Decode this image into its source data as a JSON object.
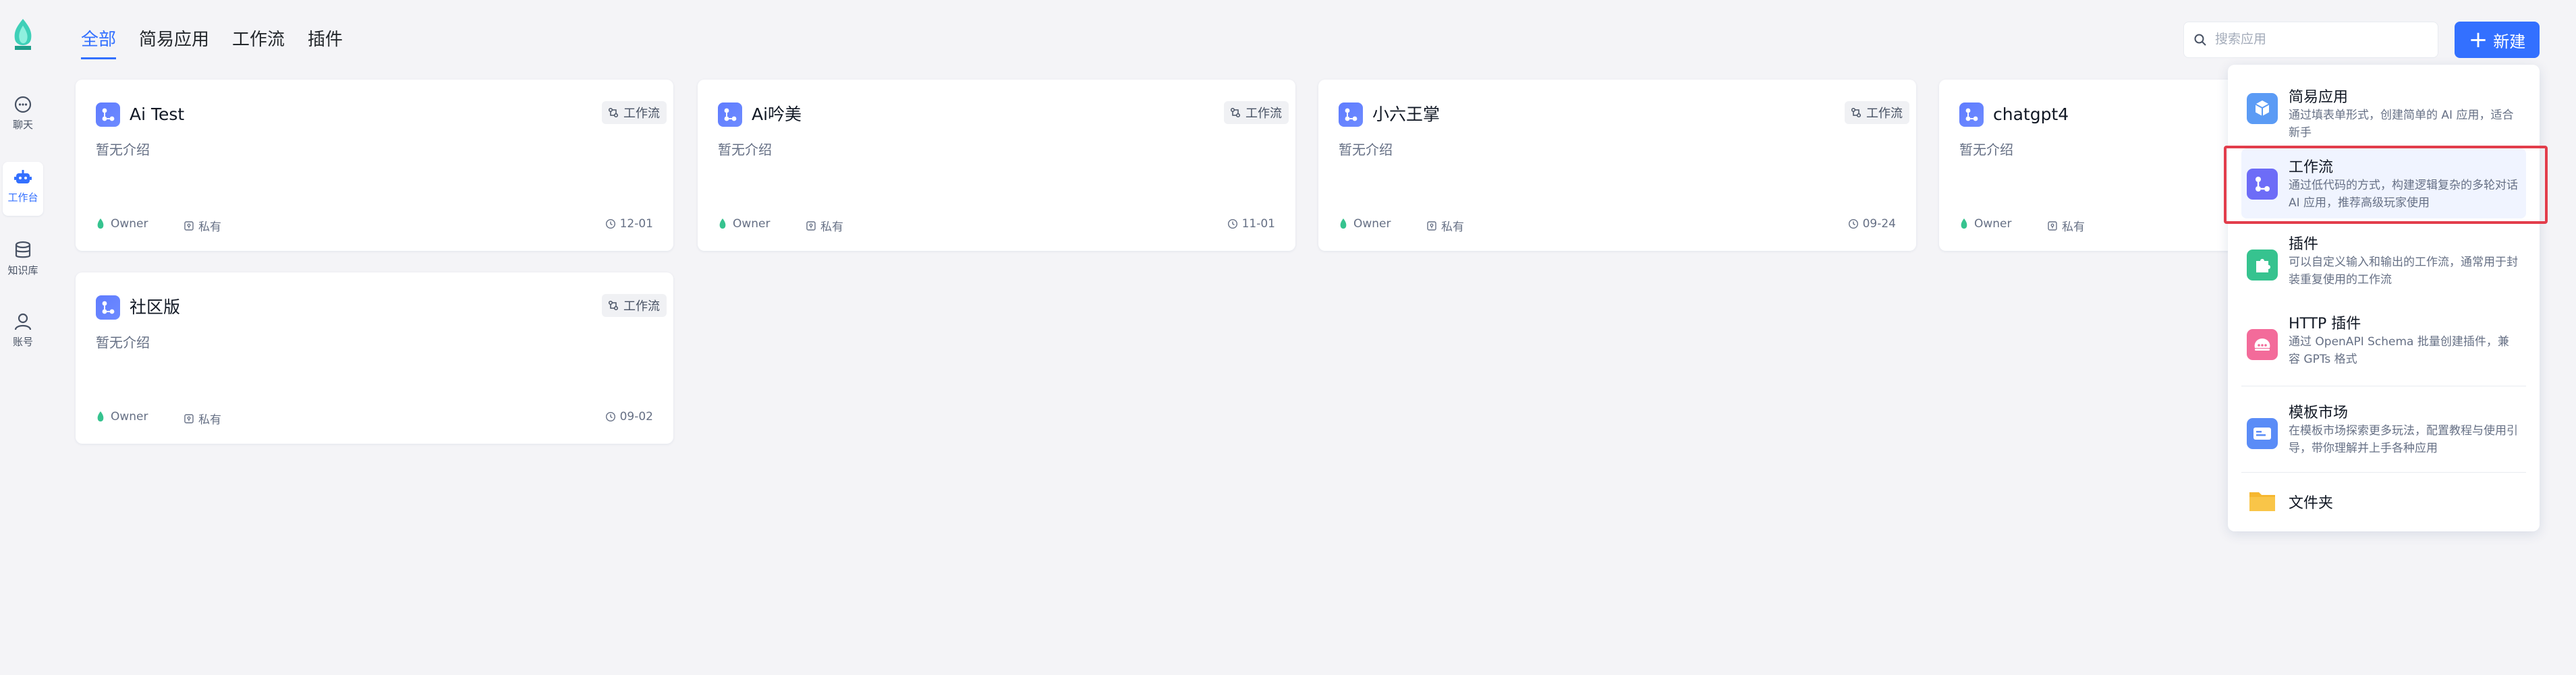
{
  "rail": {
    "items": [
      {
        "label": "聊天",
        "icon": "chat-icon",
        "active": false
      },
      {
        "label": "工作台",
        "icon": "robot-icon",
        "active": true
      },
      {
        "label": "知识库",
        "icon": "database-icon",
        "active": false
      },
      {
        "label": "账号",
        "icon": "user-icon",
        "active": false
      }
    ]
  },
  "tabs": [
    "全部",
    "简易应用",
    "工作流",
    "插件"
  ],
  "search": {
    "placeholder": "搜索应用"
  },
  "new_button": {
    "label": "新建"
  },
  "cards": [
    {
      "title": "Ai Test",
      "type": "工作流",
      "desc": "暂无介绍",
      "owner": "Owner",
      "privacy": "私有",
      "date": "12-01"
    },
    {
      "title": "Ai吟美",
      "type": "工作流",
      "desc": "暂无介绍",
      "owner": "Owner",
      "privacy": "私有",
      "date": "11-01"
    },
    {
      "title": "小六王掌",
      "type": "工作流",
      "desc": "暂无介绍",
      "owner": "Owner",
      "privacy": "私有",
      "date": "09-24"
    },
    {
      "title": "chatgpt4",
      "type": "工作流",
      "desc": "暂无介绍",
      "owner": "Owner",
      "privacy": "私有",
      "date": ""
    },
    {
      "title": "社区版",
      "type": "工作流",
      "desc": "暂无介绍",
      "owner": "Owner",
      "privacy": "私有",
      "date": "09-02"
    }
  ],
  "menu": {
    "items": [
      {
        "title": "简易应用",
        "desc": "通过填表单形式，创建简单的 AI 应用，适合新手",
        "icon": "cube-icon",
        "color": "#5b9bf5"
      },
      {
        "title": "工作流",
        "desc": "通过低代码的方式，构建逻辑复杂的多轮对话 AI 应用，推荐高级玩家使用",
        "icon": "workflow-icon",
        "color": "#6d6cf7"
      },
      {
        "title": "插件",
        "desc": "可以自定义输入和输出的工作流，通常用于封装重复使用的工作流",
        "icon": "puzzle-icon",
        "color": "#36c38f"
      },
      {
        "title": "HTTP 插件",
        "desc": "通过 OpenAPI Schema 批量创建插件，兼容 GPTs 格式",
        "icon": "http-icon",
        "color": "#f36b9a"
      },
      {
        "title": "模板市场",
        "desc": "在模板市场探索更多玩法，配置教程与使用引导，带你理解并上手各种应用",
        "icon": "template-icon",
        "color": "#5a8cf7"
      },
      {
        "title": "文件夹",
        "desc": "",
        "icon": "folder-icon",
        "color": "#f6b730"
      }
    ]
  }
}
